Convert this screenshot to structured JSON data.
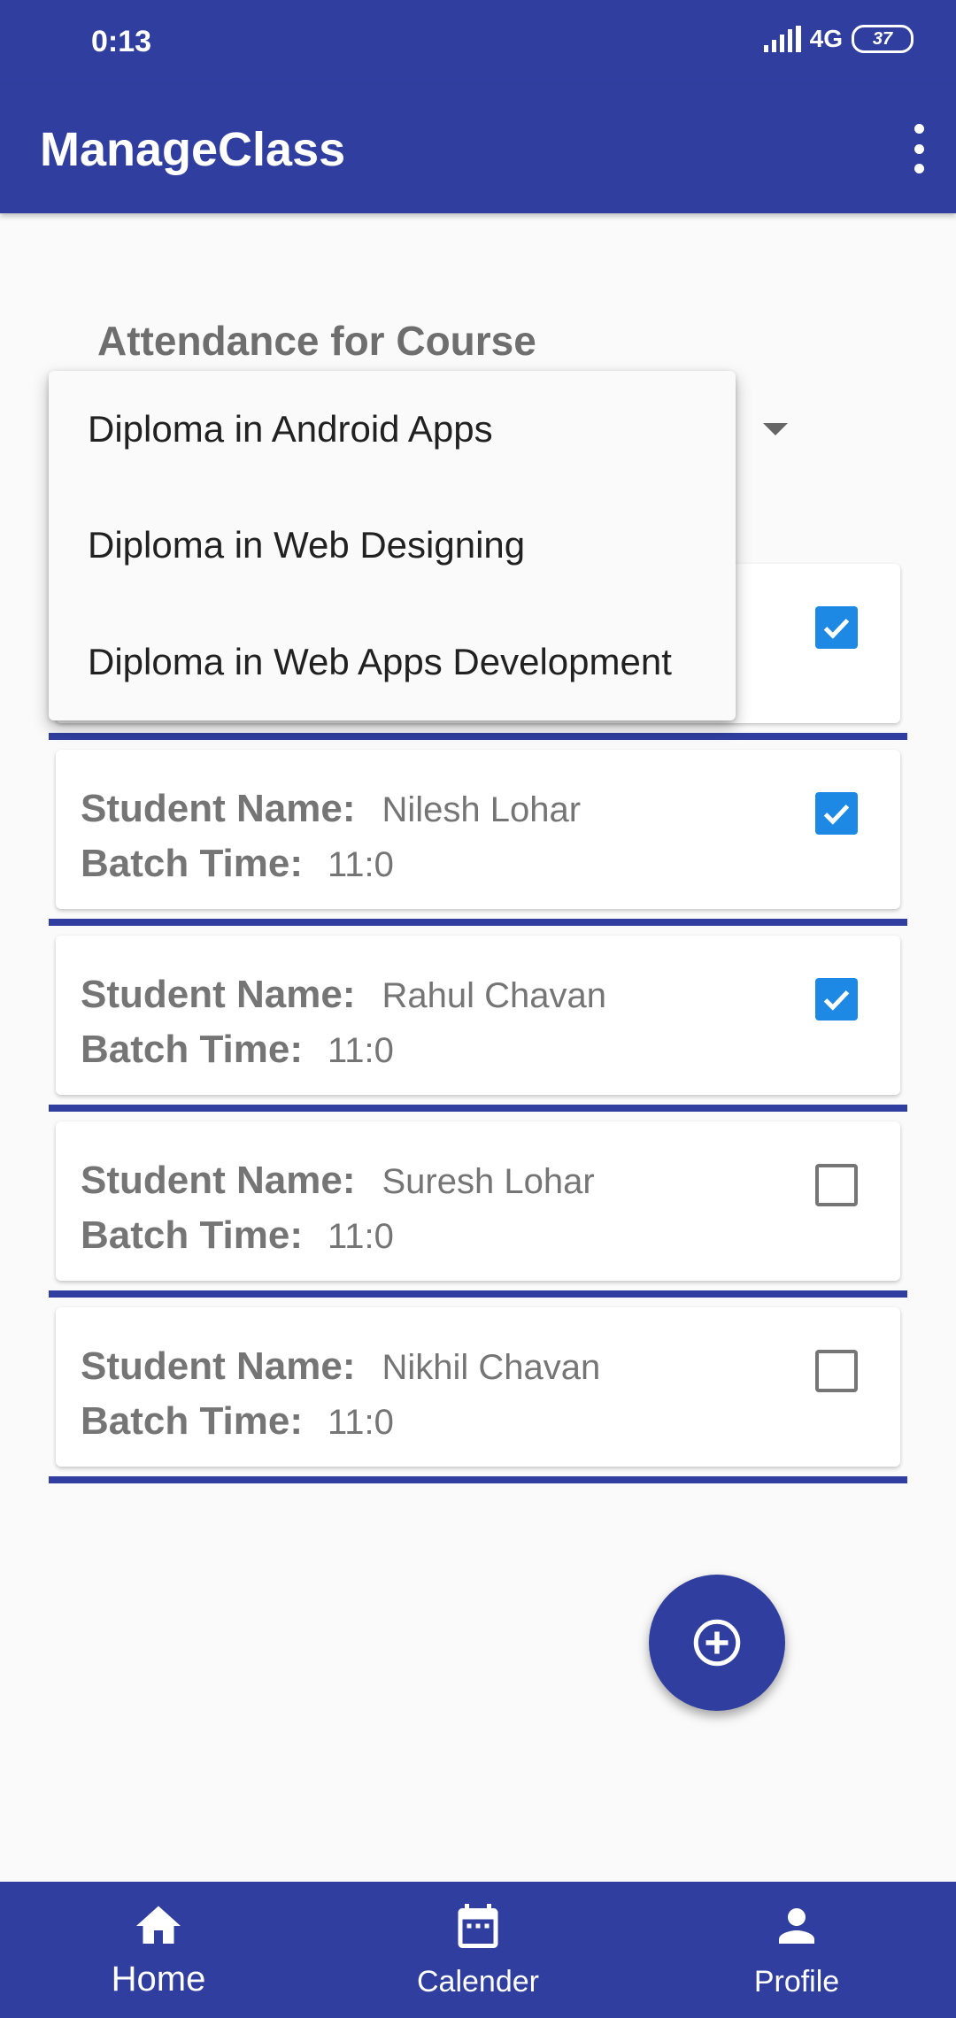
{
  "status_bar": {
    "time": "0:13",
    "network": "4G",
    "battery": "37"
  },
  "app_bar": {
    "title": "ManageClass",
    "overflow_icon": "more-vert-icon"
  },
  "attendance": {
    "heading": "Attendance for Course",
    "student_label": "Student Name:",
    "batch_label": "Batch Time:"
  },
  "course_dropdown": {
    "options": [
      "Diploma in Android Apps",
      "Diploma in Web Designing",
      "Diploma in Web Apps Development"
    ]
  },
  "students": [
    {
      "name": "",
      "batch_time": "",
      "present": true
    },
    {
      "name": "Nilesh Lohar",
      "batch_time": "11:0",
      "present": true
    },
    {
      "name": "Rahul Chavan",
      "batch_time": "11:0",
      "present": true
    },
    {
      "name": "Suresh Lohar",
      "batch_time": "11:0",
      "present": false
    },
    {
      "name": "Nikhil Chavan",
      "batch_time": "11:0",
      "present": false
    }
  ],
  "fab": {
    "icon": "add-circle-icon"
  },
  "bottom_nav": {
    "items": [
      {
        "label": "Home",
        "icon": "home-icon"
      },
      {
        "label": "Calender",
        "icon": "calendar-icon"
      },
      {
        "label": "Profile",
        "icon": "person-icon"
      }
    ]
  },
  "colors": {
    "primary": "#303f9f",
    "checkbox": "#1e88e5",
    "text_grey": "#757575"
  }
}
